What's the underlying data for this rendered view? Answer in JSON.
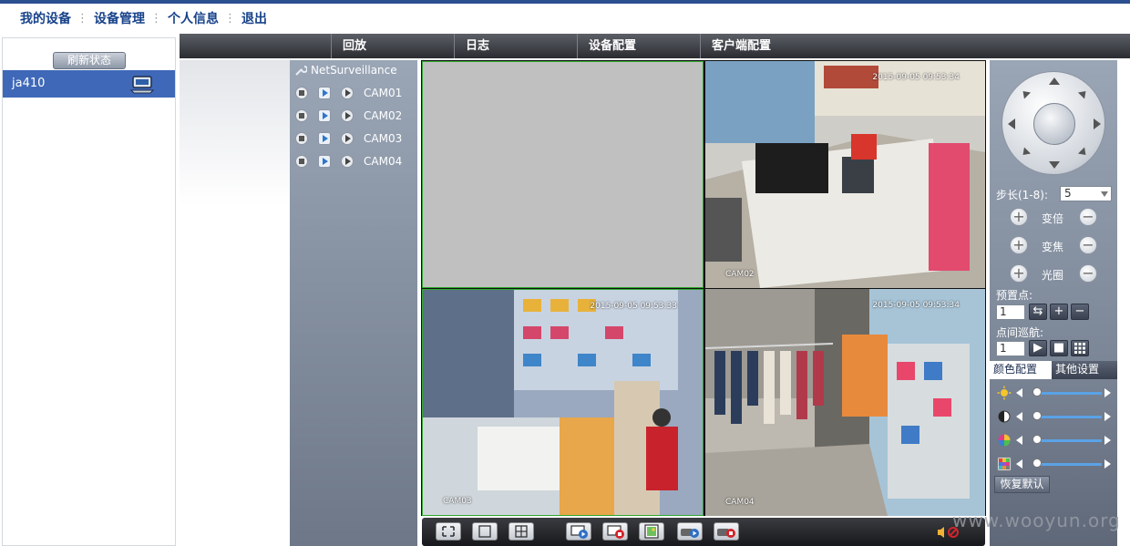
{
  "top_menu": {
    "my_devices": "我的设备",
    "device_management": "设备管理",
    "personal_info": "个人信息",
    "logout": "退出"
  },
  "left_panel": {
    "refresh_label": "刷新状态",
    "device_name": "ja410"
  },
  "tabs": [
    "回放",
    "日志",
    "设备配置",
    "客户端配置"
  ],
  "camera_tree": {
    "root": "NetSurveillance",
    "cameras": [
      "CAM01",
      "CAM02",
      "CAM03",
      "CAM04"
    ]
  },
  "video": {
    "cam02": {
      "timestamp": "2015-09-05 09:53:34",
      "label": "CAM02"
    },
    "cam03": {
      "timestamp": "2015-09-05 09:53:33",
      "label": "CAM03"
    },
    "cam04": {
      "timestamp": "2015-09-05 09:53:34",
      "label": "CAM04"
    }
  },
  "ptz": {
    "step_label": "步长(1-8):",
    "step_value": "5",
    "zoom_label": "变倍",
    "focus_label": "变焦",
    "iris_label": "光圈",
    "preset_label": "预置点:",
    "preset_value": "1",
    "cruise_label": "点间巡航:",
    "cruise_value": "1"
  },
  "color_tabs": {
    "color_config": "颜色配置",
    "other_settings": "其他设置"
  },
  "restore_label": "恢复默认",
  "watermark": "www.wooyun.org"
}
